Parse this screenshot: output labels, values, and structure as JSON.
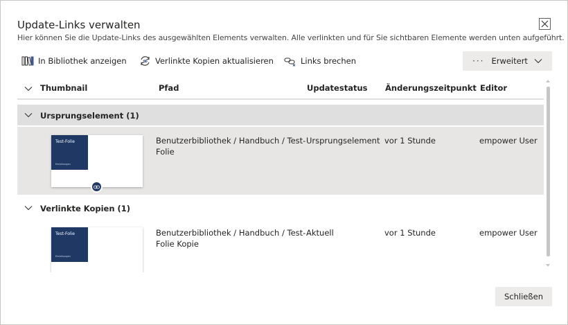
{
  "dialog": {
    "title": "Update-Links verwalten",
    "subtitle": "Hier können Sie die Update-Links des ausgewählten Elements verwalten. Alle verlinkten und für Sie sichtbaren Elemente werden unten aufgeführt.",
    "close_icon": "close-icon"
  },
  "toolbar": {
    "show_in_library": "In Bibliothek anzeigen",
    "update_copies": "Verlinkte Kopien aktualisieren",
    "break_links": "Links brechen",
    "more_dots": "···",
    "advanced": "Erweitert"
  },
  "table": {
    "columns": [
      "Thumbnail",
      "Pfad",
      "Updatestatus",
      "Änderungszeitpunkt",
      "Editor"
    ],
    "groups": [
      {
        "label": "Ursprungselement (1)",
        "rows": [
          {
            "thumbnail_title": "Test-Folie",
            "thumbnail_subtitle": "Einleitungen",
            "path_line1": "Benutzerbibliothek / Handbuch / Test-",
            "path_line2": "Folie",
            "status": "Ursprungselement",
            "changed": "vor 1 Stunde",
            "editor": "empower User"
          }
        ]
      },
      {
        "label": "Verlinkte Kopien (1)",
        "rows": [
          {
            "thumbnail_title": "Test-Folie",
            "thumbnail_subtitle": "Einleitungen",
            "path_line1": "Benutzerbibliothek / Handbuch / Test-",
            "path_line2": "Folie Kopie",
            "status": "Aktuell",
            "changed": "vor 1 Stunde",
            "editor": "empower User"
          }
        ]
      }
    ]
  },
  "footer": {
    "close_button": "Schließen"
  },
  "colors": {
    "selected_bg": "#e7e6e5",
    "group_bg": "#dfdfdf",
    "thumb_blue": "#1f3864",
    "button_bg": "#edebe9"
  }
}
